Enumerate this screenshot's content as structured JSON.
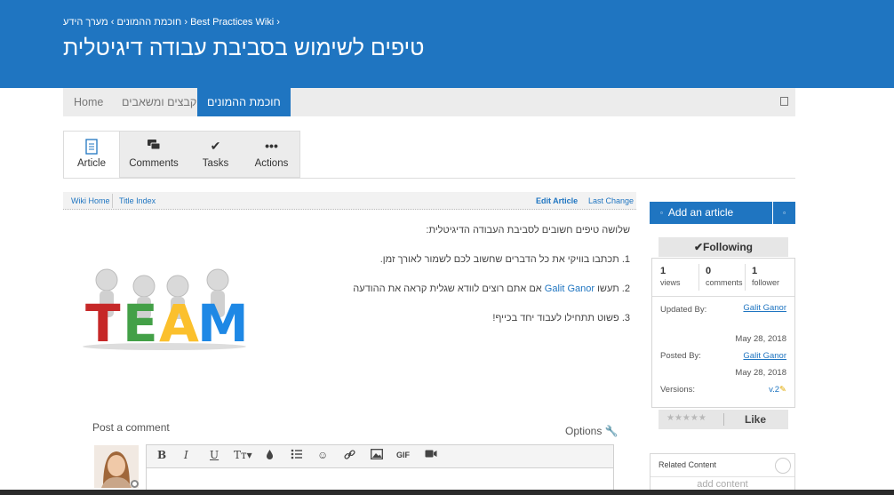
{
  "header": {
    "breadcrumb": {
      "item1": "Best Practices Wiki",
      "item2": "מערך הידע",
      "item3": "חוכמת ההמונים",
      "separator": "›"
    },
    "title": "טיפים לשימוש בסביבת עבודה דיגיטלית",
    "background_color": "#1f75c1"
  },
  "nav": {
    "home": "Home",
    "files": "קבצים ומשאבים",
    "wisdom": "חוכמת ההמונים",
    "menu_icon": "square-icon"
  },
  "tabs": {
    "article": {
      "label": "Article",
      "icon": "document-icon"
    },
    "comments": {
      "label": "Comments",
      "icon": "chat-icon"
    },
    "tasks": {
      "label": "Tasks",
      "icon": "check-icon"
    },
    "actions": {
      "label": "Actions",
      "icon": "ellipsis-icon"
    }
  },
  "wiki_bar": {
    "home": "Wiki Home",
    "index": "Title Index",
    "edit": "Edit Article",
    "last_change": "Last Change"
  },
  "article": {
    "intro": "שלושה טיפים חשובים לסביבת העבודה הדיגיטלית:",
    "tip1": "1. תכתבו בוויקי את כל הדברים שחשוב לכם לשמור לאורך זמן.",
    "tip2_before": "2. תעשו",
    "tip2_mention": "Galit Ganor",
    "tip2_after": "אם אתם רוצים לוודא שגלית קראה את ההודעה",
    "tip3": "3. פשוט תתחילו לעבוד יחד בכייף!",
    "image_letters": [
      "T",
      "E",
      "A",
      "M"
    ]
  },
  "comment": {
    "title": "Post a comment",
    "options": "Options",
    "toolbar": {
      "bold": "B",
      "italic": "I",
      "underline": "U",
      "text_size": "Tт▾",
      "gif": "GIF"
    }
  },
  "sidebar": {
    "add_article": "Add an article",
    "following": "✔Following",
    "stats": {
      "views_num": "1",
      "views_label": "views",
      "comments_num": "0",
      "comments_label": "comments",
      "followers_num": "1",
      "followers_label": "follower"
    },
    "updated_by_label": "Updated By:",
    "updated_by": "Galit Ganor",
    "updated_date": "May 28, 2018",
    "posted_by_label": "Posted By:",
    "posted_by": "Galit Ganor",
    "posted_date": "May 28, 2018",
    "versions_label": "Versions:",
    "versions": "v.2",
    "rating": "★★★★★",
    "like": "Like",
    "related_title": "Related Content",
    "add_content": "add content"
  }
}
